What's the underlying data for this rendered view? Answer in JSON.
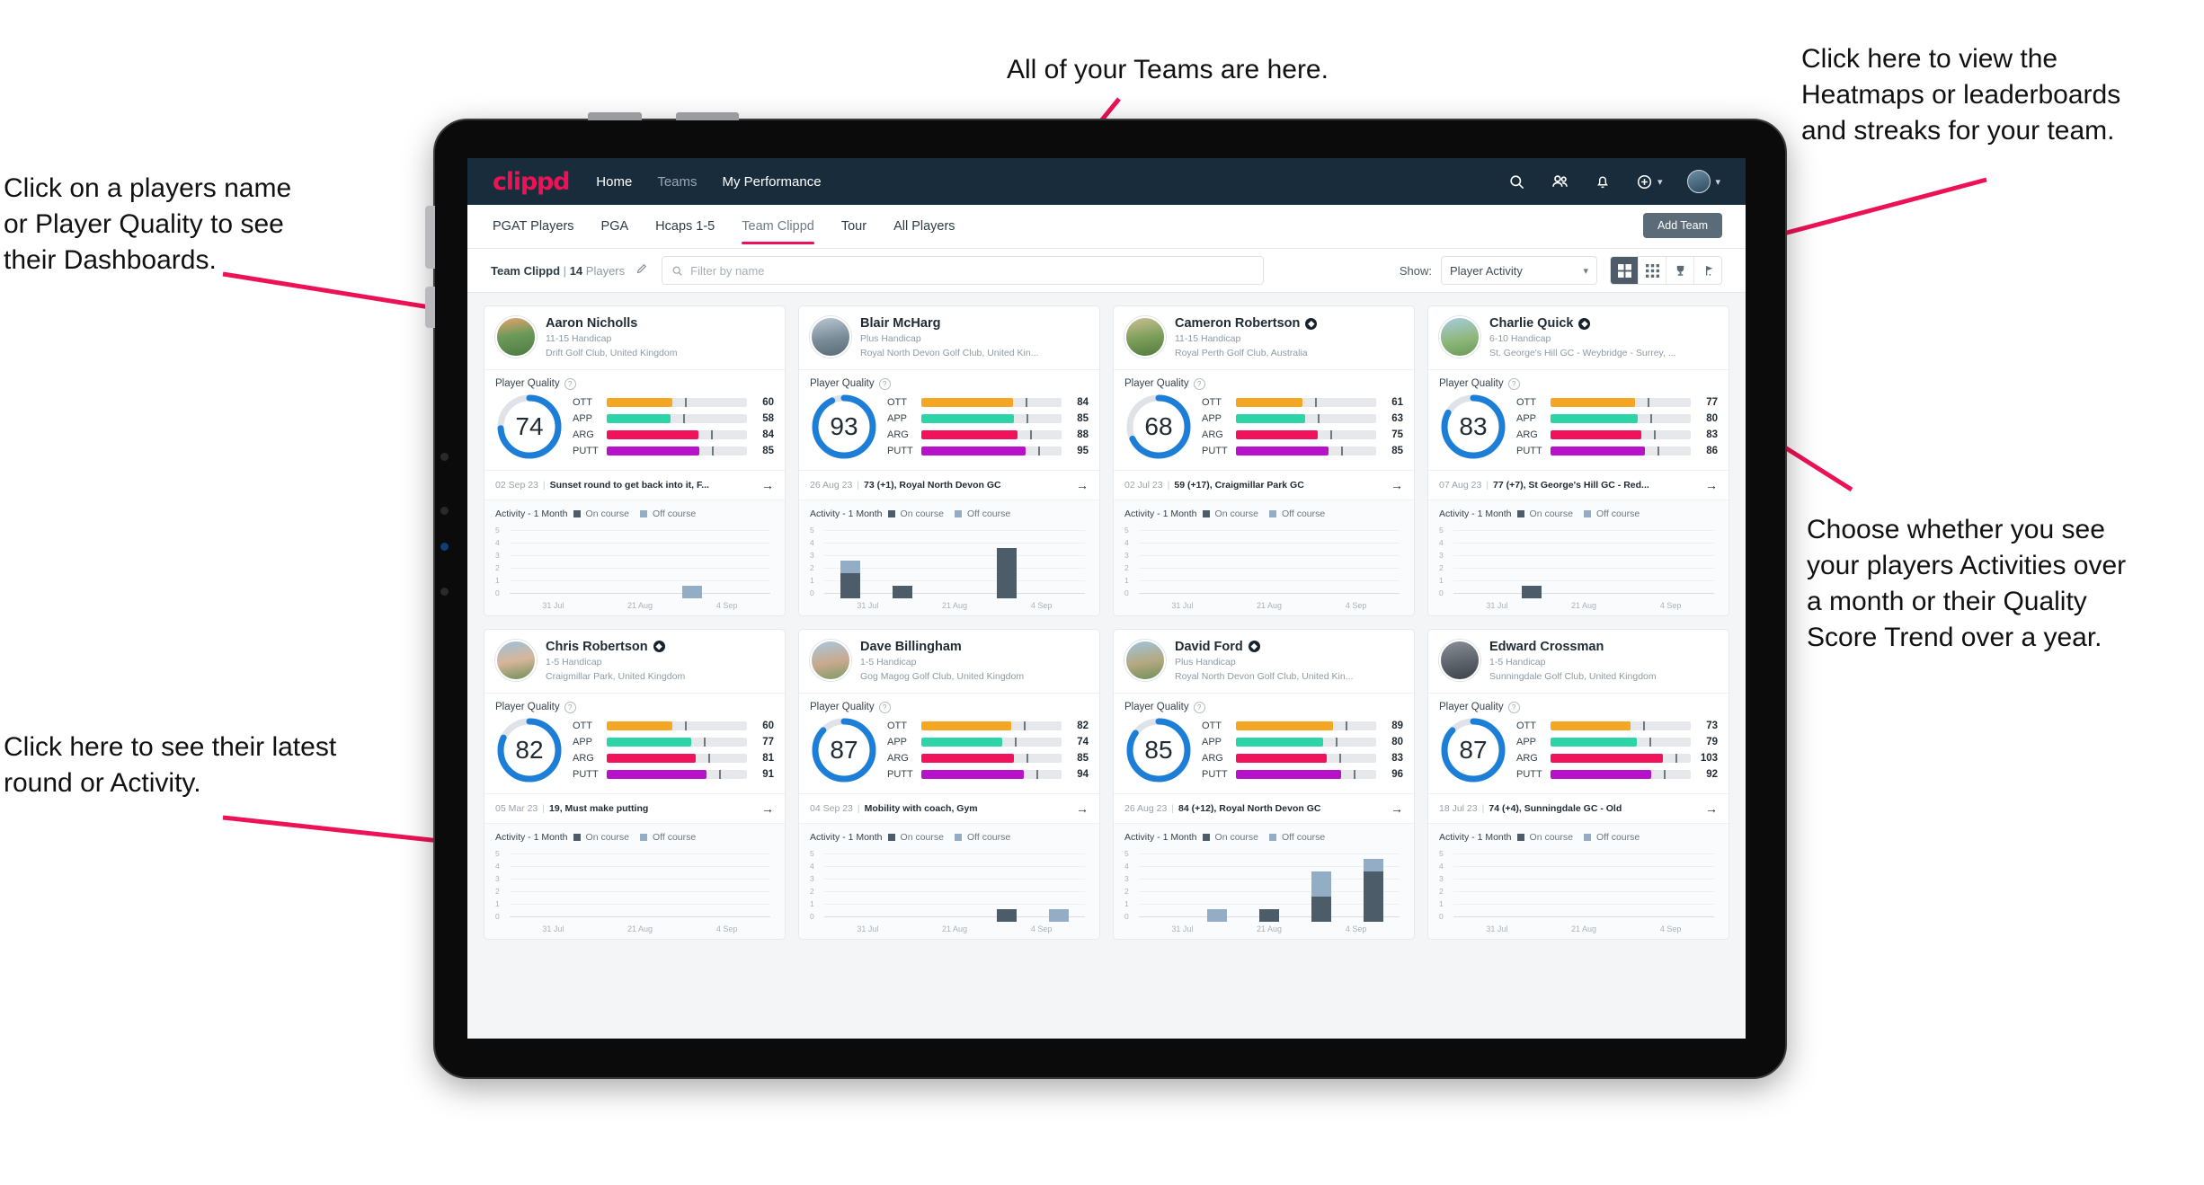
{
  "annotations": [
    {
      "id": "teams-note",
      "text": "All of your Teams are here."
    },
    {
      "id": "heatmaps-note",
      "text": "Click here to view the\nHeatmaps or leaderboards\nand streaks for your team."
    },
    {
      "id": "players-note",
      "text": "Click on a players name\nor Player Quality to see\ntheir Dashboards."
    },
    {
      "id": "activity-choice-note",
      "text": "Choose whether you see\nyour players Activities over\na month or their Quality\nScore Trend over a year."
    },
    {
      "id": "latest-round-note",
      "text": "Click here to see their latest\nround or Activity."
    }
  ],
  "navbar": {
    "logo": "clippd",
    "links": [
      {
        "label": "Home",
        "active": true
      },
      {
        "label": "Teams",
        "active": false
      },
      {
        "label": "My Performance",
        "active": true
      }
    ],
    "icons": [
      "search-icon",
      "people-icon",
      "bell-icon",
      "add-circle-icon",
      "avatar"
    ]
  },
  "tabs": [
    {
      "label": "PGAT Players",
      "active": false
    },
    {
      "label": "PGA",
      "active": false
    },
    {
      "label": "Hcaps 1-5",
      "active": false
    },
    {
      "label": "Team Clippd",
      "active": true
    },
    {
      "label": "Tour",
      "active": false
    },
    {
      "label": "All Players",
      "active": false
    }
  ],
  "add_team_label": "Add Team",
  "filterbar": {
    "team_name": "Team Clippd",
    "separator": "|",
    "player_count": "14",
    "players_word": "Players",
    "search_placeholder": "Filter by name",
    "show_label": "Show:",
    "show_value": "Player Activity",
    "view_buttons": [
      "grid-view-icon",
      "dense-grid-icon",
      "trophy-icon",
      "golf-flag-icon"
    ],
    "active_view_index": 0
  },
  "card_labels": {
    "player_quality": "Player Quality",
    "activity": "Activity - 1 Month",
    "legend_on": "On course",
    "legend_off": "Off course",
    "y_ticks": [
      "5",
      "4",
      "3",
      "2",
      "1",
      "0"
    ],
    "x_ticks": [
      "31 Jul",
      "21 Aug",
      "4 Sep"
    ]
  },
  "colors": {
    "accent": "#ec1255",
    "navbar": "#182c3b",
    "ring": "#1c7ed6",
    "ott": "#f5a623",
    "app": "#2dd4a7",
    "arg": "#f1125c",
    "putt": "#b712c9",
    "on_course": "#4c5c68",
    "off_course": "#93aec4"
  },
  "players": [
    {
      "name": "Aaron Nicholls",
      "verified": false,
      "handicap": "11-15 Handicap",
      "club": "Drift Golf Club, United Kingdom",
      "quality": 74,
      "metrics": [
        {
          "label": "OTT",
          "value": 60
        },
        {
          "label": "APP",
          "value": 58
        },
        {
          "label": "ARG",
          "value": 84
        },
        {
          "label": "PUTT",
          "value": 85
        }
      ],
      "last_date": "02 Sep 23",
      "last_text": "Sunset round to get back into it, F...",
      "activity": [
        {
          "on": 0,
          "off": 0
        },
        {
          "on": 0,
          "off": 0
        },
        {
          "on": 0,
          "off": 0
        },
        {
          "on": 0,
          "off": 1
        },
        {
          "on": 0,
          "off": 0
        }
      ]
    },
    {
      "name": "Blair McHarg",
      "verified": false,
      "handicap": "Plus Handicap",
      "club": "Royal North Devon Golf Club, United Kin...",
      "quality": 93,
      "metrics": [
        {
          "label": "OTT",
          "value": 84
        },
        {
          "label": "APP",
          "value": 85
        },
        {
          "label": "ARG",
          "value": 88
        },
        {
          "label": "PUTT",
          "value": 95
        }
      ],
      "last_date": "26 Aug 23",
      "last_text": "73 (+1), Royal North Devon GC",
      "activity": [
        {
          "on": 2,
          "off": 1
        },
        {
          "on": 1,
          "off": 0
        },
        {
          "on": 0,
          "off": 0
        },
        {
          "on": 4,
          "off": 0
        },
        {
          "on": 0,
          "off": 0
        }
      ]
    },
    {
      "name": "Cameron Robertson",
      "verified": true,
      "handicap": "11-15 Handicap",
      "club": "Royal Perth Golf Club, Australia",
      "quality": 68,
      "metrics": [
        {
          "label": "OTT",
          "value": 61
        },
        {
          "label": "APP",
          "value": 63
        },
        {
          "label": "ARG",
          "value": 75
        },
        {
          "label": "PUTT",
          "value": 85
        }
      ],
      "last_date": "02 Jul 23",
      "last_text": "59 (+17), Craigmillar Park GC",
      "activity": [
        {
          "on": 0,
          "off": 0
        },
        {
          "on": 0,
          "off": 0
        },
        {
          "on": 0,
          "off": 0
        },
        {
          "on": 0,
          "off": 0
        },
        {
          "on": 0,
          "off": 0
        }
      ]
    },
    {
      "name": "Charlie Quick",
      "verified": true,
      "handicap": "6-10 Handicap",
      "club": "St. George's Hill GC - Weybridge - Surrey, ...",
      "quality": 83,
      "metrics": [
        {
          "label": "OTT",
          "value": 77
        },
        {
          "label": "APP",
          "value": 80
        },
        {
          "label": "ARG",
          "value": 83
        },
        {
          "label": "PUTT",
          "value": 86
        }
      ],
      "last_date": "07 Aug 23",
      "last_text": "77 (+7), St George's Hill GC - Red...",
      "activity": [
        {
          "on": 0,
          "off": 0
        },
        {
          "on": 1,
          "off": 0
        },
        {
          "on": 0,
          "off": 0
        },
        {
          "on": 0,
          "off": 0
        },
        {
          "on": 0,
          "off": 0
        }
      ]
    },
    {
      "name": "Chris Robertson",
      "verified": true,
      "handicap": "1-5 Handicap",
      "club": "Craigmillar Park, United Kingdom",
      "quality": 82,
      "metrics": [
        {
          "label": "OTT",
          "value": 60
        },
        {
          "label": "APP",
          "value": 77
        },
        {
          "label": "ARG",
          "value": 81
        },
        {
          "label": "PUTT",
          "value": 91
        }
      ],
      "last_date": "05 Mar 23",
      "last_text": "19, Must make putting",
      "activity": [
        {
          "on": 0,
          "off": 0
        },
        {
          "on": 0,
          "off": 0
        },
        {
          "on": 0,
          "off": 0
        },
        {
          "on": 0,
          "off": 0
        },
        {
          "on": 0,
          "off": 0
        }
      ]
    },
    {
      "name": "Dave Billingham",
      "verified": false,
      "handicap": "1-5 Handicap",
      "club": "Gog Magog Golf Club, United Kingdom",
      "quality": 87,
      "metrics": [
        {
          "label": "OTT",
          "value": 82
        },
        {
          "label": "APP",
          "value": 74
        },
        {
          "label": "ARG",
          "value": 85
        },
        {
          "label": "PUTT",
          "value": 94
        }
      ],
      "last_date": "04 Sep 23",
      "last_text": "Mobility with coach, Gym",
      "activity": [
        {
          "on": 0,
          "off": 0
        },
        {
          "on": 0,
          "off": 0
        },
        {
          "on": 0,
          "off": 0
        },
        {
          "on": 1,
          "off": 0
        },
        {
          "on": 0,
          "off": 1
        }
      ]
    },
    {
      "name": "David Ford",
      "verified": true,
      "handicap": "Plus Handicap",
      "club": "Royal North Devon Golf Club, United Kin...",
      "quality": 85,
      "metrics": [
        {
          "label": "OTT",
          "value": 89
        },
        {
          "label": "APP",
          "value": 80
        },
        {
          "label": "ARG",
          "value": 83
        },
        {
          "label": "PUTT",
          "value": 96
        }
      ],
      "last_date": "26 Aug 23",
      "last_text": "84 (+12), Royal North Devon GC",
      "activity": [
        {
          "on": 0,
          "off": 0
        },
        {
          "on": 0,
          "off": 1
        },
        {
          "on": 1,
          "off": 0
        },
        {
          "on": 2,
          "off": 2
        },
        {
          "on": 4,
          "off": 1
        }
      ]
    },
    {
      "name": "Edward Crossman",
      "verified": false,
      "handicap": "1-5 Handicap",
      "club": "Sunningdale Golf Club, United Kingdom",
      "quality": 87,
      "metrics": [
        {
          "label": "OTT",
          "value": 73
        },
        {
          "label": "APP",
          "value": 79
        },
        {
          "label": "ARG",
          "value": 103
        },
        {
          "label": "PUTT",
          "value": 92
        }
      ],
      "last_date": "18 Jul 23",
      "last_text": "74 (+4), Sunningdale GC - Old",
      "activity": [
        {
          "on": 0,
          "off": 0
        },
        {
          "on": 0,
          "off": 0
        },
        {
          "on": 0,
          "off": 0
        },
        {
          "on": 0,
          "off": 0
        },
        {
          "on": 0,
          "off": 0
        }
      ]
    }
  ]
}
